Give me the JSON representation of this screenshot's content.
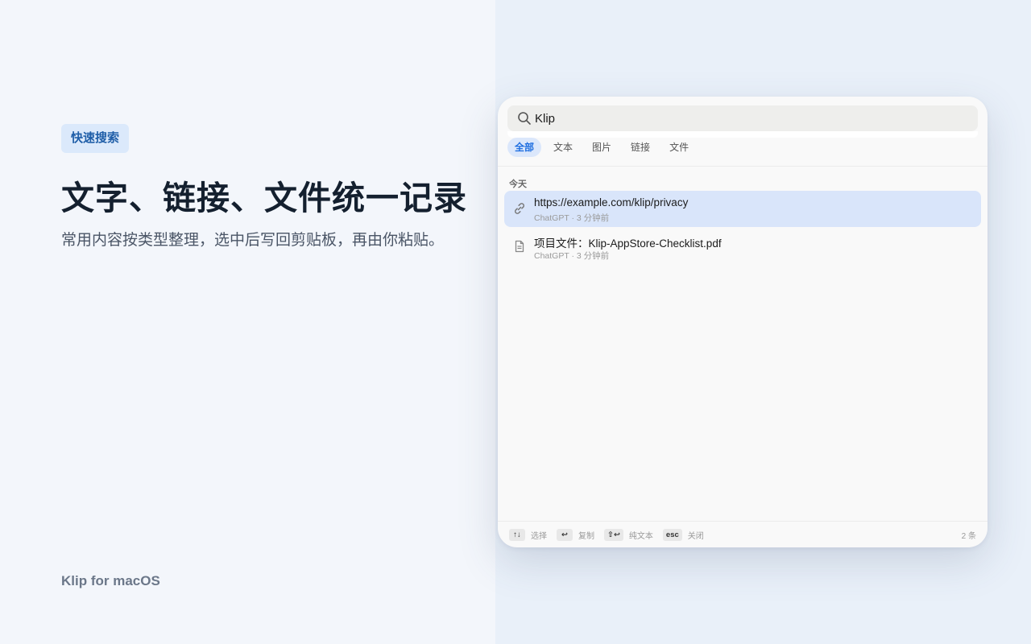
{
  "hero": {
    "badge": "快速搜索",
    "headline": "文字、链接、文件统一记录",
    "subtitle": "常用内容按类型整理，选中后写回剪贴板，再由你粘贴。",
    "brand": "Klip for macOS"
  },
  "panel": {
    "search": {
      "value": "Klip",
      "icon": "search-icon"
    },
    "tabs": [
      {
        "label": "全部",
        "active": true
      },
      {
        "label": "文本",
        "active": false
      },
      {
        "label": "图片",
        "active": false
      },
      {
        "label": "链接",
        "active": false
      },
      {
        "label": "文件",
        "active": false
      }
    ],
    "section": "今天",
    "items": [
      {
        "icon": "link-icon",
        "title": "https://example.com/klip/privacy",
        "meta": "ChatGPT · 3 分钟前",
        "selected": true
      },
      {
        "icon": "document-icon",
        "title": "项目文件：Klip-AppStore-Checklist.pdf",
        "meta": "ChatGPT · 3 分钟前",
        "selected": false
      }
    ],
    "footer": {
      "hints": [
        {
          "key": "↑↓",
          "label": "选择"
        },
        {
          "key": "↩",
          "label": "复制"
        },
        {
          "key": "⇧↩",
          "label": "纯文本"
        },
        {
          "key": "esc",
          "label": "关闭"
        }
      ],
      "count": "2 条"
    }
  },
  "colors": {
    "accent": "#1f6fe0",
    "selected_row": "#d9e5fa",
    "badge_bg": "#dbe9fb"
  }
}
